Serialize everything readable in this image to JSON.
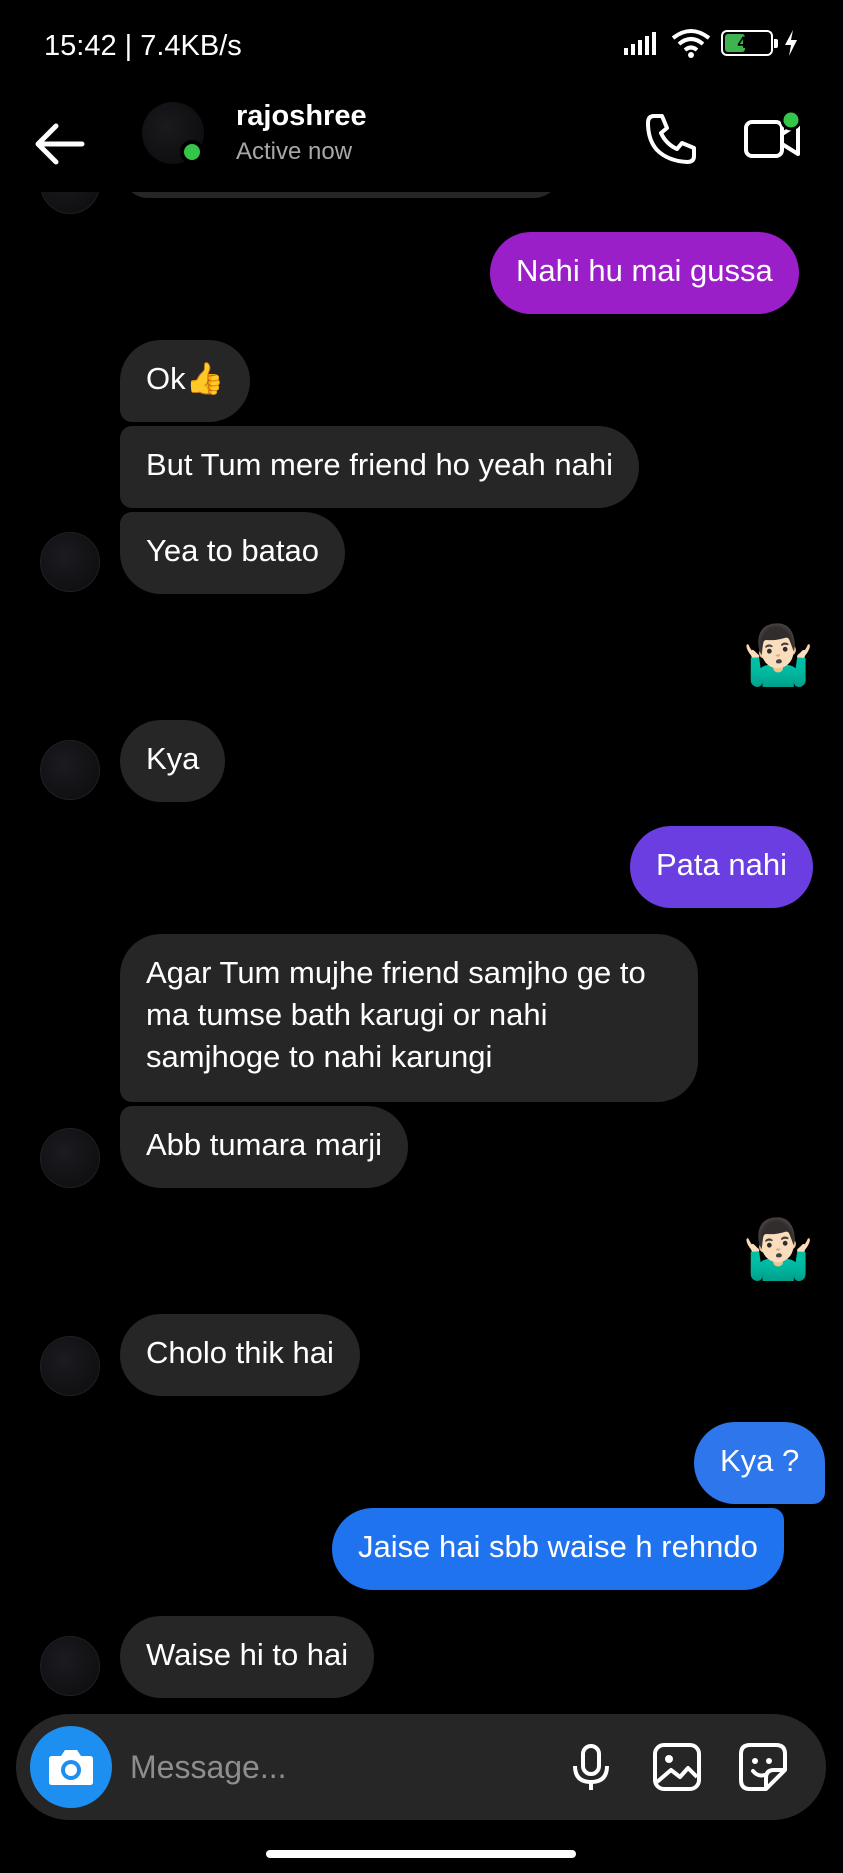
{
  "status_bar": {
    "time_speed": "15:42 | 7.4KB/s",
    "battery_level": "41"
  },
  "header": {
    "name": "rajoshree",
    "status": "Active now"
  },
  "messages": [
    {
      "from": "me",
      "text": "Nahi hu mai gussa",
      "color": "#9b1fc9"
    },
    {
      "from": "them",
      "text": "Ok👍"
    },
    {
      "from": "them",
      "text": "But Tum mere friend ho yeah nahi"
    },
    {
      "from": "them",
      "text": "Yea to batao"
    },
    {
      "from": "me",
      "text": "🤷🏻‍♂️",
      "type": "emoji"
    },
    {
      "from": "them",
      "text": "Kya"
    },
    {
      "from": "me",
      "text": "Pata nahi",
      "color": "#6a3ee0"
    },
    {
      "from": "them",
      "text": "Agar Tum mujhe friend samjho ge to ma tumse bath karugi or nahi samjhoge to nahi karungi"
    },
    {
      "from": "them",
      "text": "Abb tumara marji"
    },
    {
      "from": "me",
      "text": "🤷🏻‍♂️",
      "type": "emoji"
    },
    {
      "from": "them",
      "text": "Cholo thik hai"
    },
    {
      "from": "me",
      "text": "Kya ?",
      "color": "#2d76ec"
    },
    {
      "from": "me",
      "text": "Jaise hai sbb waise h rehndo",
      "color": "#2073ee"
    },
    {
      "from": "them",
      "text": "Waise hi to hai"
    }
  ],
  "composer": {
    "placeholder": "Message..."
  },
  "icons": [
    "back-arrow-icon",
    "phone-icon",
    "video-camera-icon",
    "camera-icon",
    "microphone-icon",
    "gallery-icon",
    "sticker-icon",
    "signal-icon",
    "wifi-icon",
    "battery-icon",
    "charging-icon"
  ]
}
